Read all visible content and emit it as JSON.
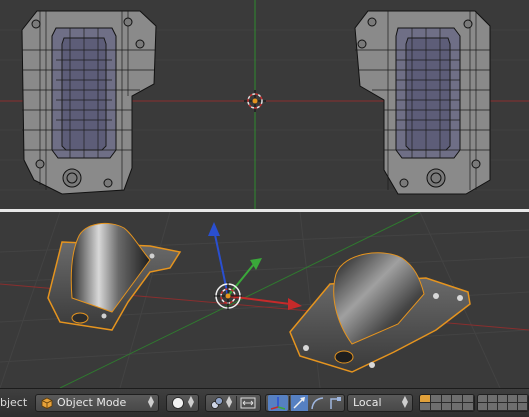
{
  "header": {
    "object_menu_label": "bject",
    "mode_selector": {
      "label": "Object Mode",
      "icon": "object-cube-icon"
    },
    "viewport_shading": {
      "icon": "solid-shading-icon"
    },
    "pivot_icons": [
      "pivot-point-icon",
      "manipulator-toggle-icon"
    ],
    "transform_icons": [
      "translate-manipulator-icon",
      "rotate-manipulator-icon",
      "scale-manipulator-icon"
    ],
    "transform_orientation": {
      "label": "Local"
    },
    "layers": {
      "active_layer": 1
    }
  },
  "viewports": {
    "top": {
      "view": "wireframe",
      "objects": [
        "bracket-left",
        "bracket-right"
      ]
    },
    "bottom": {
      "view": "perspective solid",
      "objects": [
        "bracket-back",
        "bracket-front"
      ],
      "gizmo_axes": [
        "x",
        "y",
        "z"
      ]
    }
  },
  "colors": {
    "background": "#3a3a3a",
    "axis_x": "#a12a2a",
    "axis_y": "#2f8a2f",
    "axis_z": "#2a4fd0",
    "selection": "#e5941f",
    "active_button": "#5680c2"
  }
}
